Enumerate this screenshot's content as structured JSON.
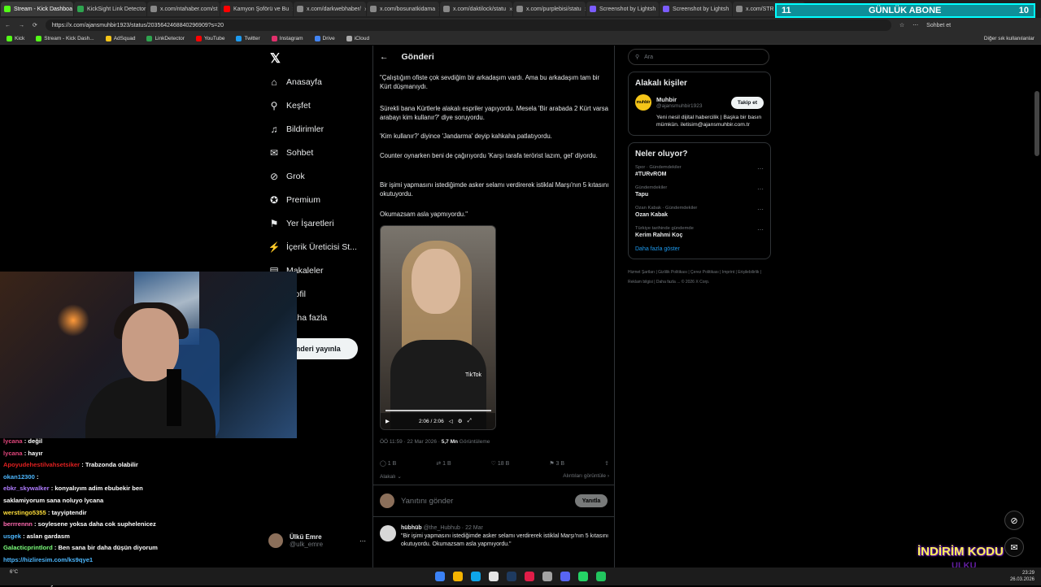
{
  "browser": {
    "tabs": [
      {
        "label": "Stream - Kick Dashboa",
        "color": "#53fc18"
      },
      {
        "label": "KickSight Link Detector",
        "color": "#2ea44f"
      },
      {
        "label": "x.com/ntahaber.com/st",
        "color": "#888"
      },
      {
        "label": "Kamyon Şoförü ve Bu",
        "color": "#ff0000"
      },
      {
        "label": "x.com/darkwebhaber/",
        "color": "#888"
      },
      {
        "label": "x.com/bosunatkidama",
        "color": "#888"
      },
      {
        "label": "x.com/daktilock/statu",
        "color": "#888"
      },
      {
        "label": "x.com/purplebisi/statu",
        "color": "#888"
      },
      {
        "label": "Screenshot by Lightsh",
        "color": "#7b5cff"
      },
      {
        "label": "Screenshot by Lightsh",
        "color": "#7b5cff"
      },
      {
        "label": "x.com/STR",
        "color": "#888"
      }
    ],
    "url": "https://x.com/ajansmuhbir1923/status/2035642468840296909?s=20",
    "bookmarks": [
      "Kick",
      "Stream - Kick Dash...",
      "AdSquad",
      "LinkDetector",
      "YouTube",
      "Twitter",
      "Instagram",
      "Drive",
      "iCloud"
    ],
    "bookmarks_right": "Diğer sık kullanılanlar",
    "sohbet": "Sohbet et"
  },
  "subscriber_banner": {
    "left": "11",
    "title": "GÜNLÜK ABONE",
    "right": "10"
  },
  "nav": {
    "items": [
      {
        "label": "Anasayfa",
        "icon": "⌂"
      },
      {
        "label": "Keşfet",
        "icon": "⚲"
      },
      {
        "label": "Bildirimler",
        "icon": "♫"
      },
      {
        "label": "Sohbet",
        "icon": "✉"
      },
      {
        "label": "Grok",
        "icon": "⊘"
      },
      {
        "label": "Premium",
        "icon": "✪"
      },
      {
        "label": "Yer İşaretleri",
        "icon": "⚑"
      },
      {
        "label": "İçerik Üreticisi St...",
        "icon": "⚡"
      },
      {
        "label": "Makaleler",
        "icon": "▤"
      },
      {
        "label": "Profil",
        "icon": "☺"
      },
      {
        "label": "Daha fazla",
        "icon": "⋯"
      }
    ],
    "post_button": "Gönderi yayınla",
    "account": {
      "name": "Ülkü Emre",
      "handle": "@ulk_emre"
    }
  },
  "post": {
    "header": "Gönderi",
    "paragraphs": [
      "\"Çalıştığım ofiste çok sevdiğim bir arkadaşım vardı. Ama bu arkadaşım tam bir Kürt düşmanıydı.",
      "Sürekli bana Kürtlerle alakalı espriler yapıyordu. Mesela 'Bir arabada 2 Kürt varsa arabayı kim kullanır?' diye soruyordu.",
      "'Kim kullanır?' diyince 'Jandarma' deyip kahkaha patlatıyordu.",
      "Counter oynarken beni de çağırıyordu 'Karşı tarafa terörist lazım, gel' diyordu.",
      "Bir işimi yapmasını istediğimde asker selamı verdirerek istiklal Marşı'nın 5 kıtasını okutuyordu.",
      "Okumazsam asla yapmıyordu.\""
    ],
    "video_time": "2:06 / 2:06",
    "video_watermark": "TikTok",
    "time": "ÖÖ 11:59 · 22 Mar 2026 · ",
    "views": "5,7 Mn",
    "views_label": " Görüntüleme",
    "stats": {
      "replies": "1 B",
      "reposts": "1 B",
      "likes": "18 B",
      "bookmarks": "3 B"
    },
    "related_left": "Alakalı ⌄",
    "related_right": "Alıntıları görüntüle ›",
    "reply_placeholder": "Yanıtını gönder",
    "reply_button": "Yanıtla",
    "quote": {
      "name": "hübhüb",
      "meta": "@the_Hubhub · 22 Mar",
      "text": "\"Bir işimi yapmasını istediğimde asker selamı verdirerek istiklal Marşı'nın 5 kıtasını okutuyordu.  Okumazsam asla yapmıyordu.\""
    }
  },
  "sidebar": {
    "search_placeholder": "Ara",
    "related_title": "Alakalı kişiler",
    "person": {
      "name": "Muhbir",
      "handle": "@ajansmuhbir1923",
      "follow": "Takip et",
      "bio": "Yeni nesil dijital habercilik | Başka bir basın mümkün. iletisim@ajansmuhbir.com.tr",
      "logo_text": "muhbir"
    },
    "trends_title": "Neler oluyor?",
    "trends": [
      {
        "category": "Spor · Gündemdekiler",
        "title": "#TURvROM"
      },
      {
        "category": "Gündemdekiler",
        "title": "Tapu"
      },
      {
        "category": "Ozan Kabak · Gündemdekiler",
        "title": "Ozan Kabak"
      },
      {
        "category": "Türkiye tarihinde gündemde",
        "title": "Kerim Rahmi Koç"
      }
    ],
    "show_more": "Daha fazla göster",
    "footer": "Hizmet Şartları  |  Gizlilik Politikası  |  Çerez Politikası  |  Imprint  |  Erişilebilirlik  |  Reklam bilgisi  |  Daha fazla ...  © 2026 X Corp."
  },
  "chat": [
    {
      "user": "lycana",
      "color": "#e0457b",
      "text": " : değil"
    },
    {
      "user": "lycana",
      "color": "#e0457b",
      "text": " : hayır"
    },
    {
      "user": "Apoyudehestilvahsetsiker",
      "color": "#e02020",
      "text": " : Trabzonda olabilir"
    },
    {
      "user": "okan12300",
      "color": "#4db8ff",
      "text": " : "
    },
    {
      "user": "ebkr_skywalker",
      "color": "#b07cff",
      "text": " : konyalıyım adim ebubekir ben"
    },
    {
      "user": "",
      "color": "#fff",
      "text": "saklamiyorum sana noluyo lycana"
    },
    {
      "user": "werstingo5355",
      "color": "#ffde3a",
      "text": " : tayyiptendir"
    },
    {
      "user": "berrrennn",
      "color": "#ff6ab0",
      "text": " : soylesene yoksa daha cok suphelenicez"
    },
    {
      "user": "usgek",
      "color": "#4db8ff",
      "text": " : aslan gardasm"
    },
    {
      "user": "Galacticprintlord",
      "color": "#7cff7c",
      "text": " : Ben sana bir daha düşün diyorum"
    },
    {
      "user": "",
      "color": "#4db8ff",
      "text": "https://hizliresim.com/ks9qye1"
    },
    {
      "user": "AYEMABEY",
      "color": "#ffde3a",
      "text": " : Hangi bölge"
    },
    {
      "user": "",
      "color": "#fff",
      "text": "anonim olsun diye"
    }
  ],
  "taskbar": {
    "time": "23:29",
    "date": "26.03.2026",
    "weather": "6°C"
  },
  "overlay": {
    "indirim": "İNDİRİM KODU",
    "code": "ULKU"
  }
}
